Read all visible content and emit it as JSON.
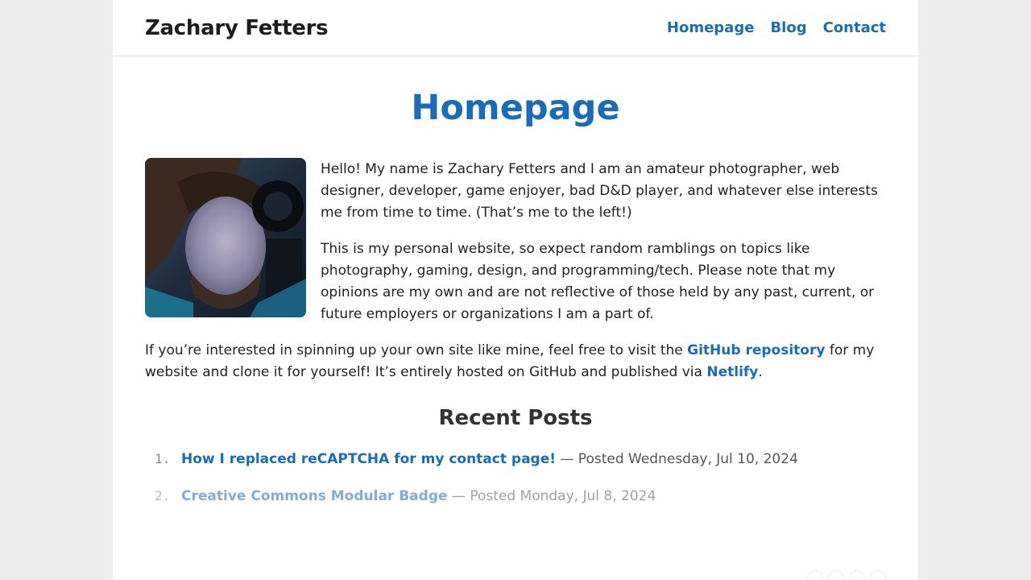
{
  "header": {
    "site_title": "Zachary Fetters",
    "nav": [
      {
        "label": "Homepage"
      },
      {
        "label": "Blog"
      },
      {
        "label": "Contact"
      }
    ]
  },
  "main": {
    "title": "Homepage",
    "intro": {
      "p1": "Hello! My name is Zachary Fetters and I am an amateur photographer, web designer, developer, game enjoyer, bad D&D player, and whatever else interests me from time to time. (That’s me to the left!)",
      "p2": "This is my personal website, so expect random ramblings on topics like photography, gaming, design, and programming/tech. Please note that my opinions are my own and are not reflective of those held by any past, current, or future employers or organizations I am a part of."
    },
    "repo_para": {
      "before": "If you’re interested in spinning up your own site like mine, feel free to visit the ",
      "link1": "GitHub repository",
      "middle": " for my website and clone it for yourself! It’s entirely hosted on GitHub and published via ",
      "link2": "Netlify",
      "after": "."
    },
    "recent_posts": {
      "title": "Recent Posts",
      "items": [
        {
          "num": "1.",
          "title": "How I replaced reCAPTCHA for my contact page!",
          "meta": " — Posted Wednesday, Jul 10, 2024"
        },
        {
          "num": "2.",
          "title": "Creative Commons Modular Badge",
          "meta": " — Posted Monday, Jul 8, 2024"
        }
      ]
    }
  }
}
